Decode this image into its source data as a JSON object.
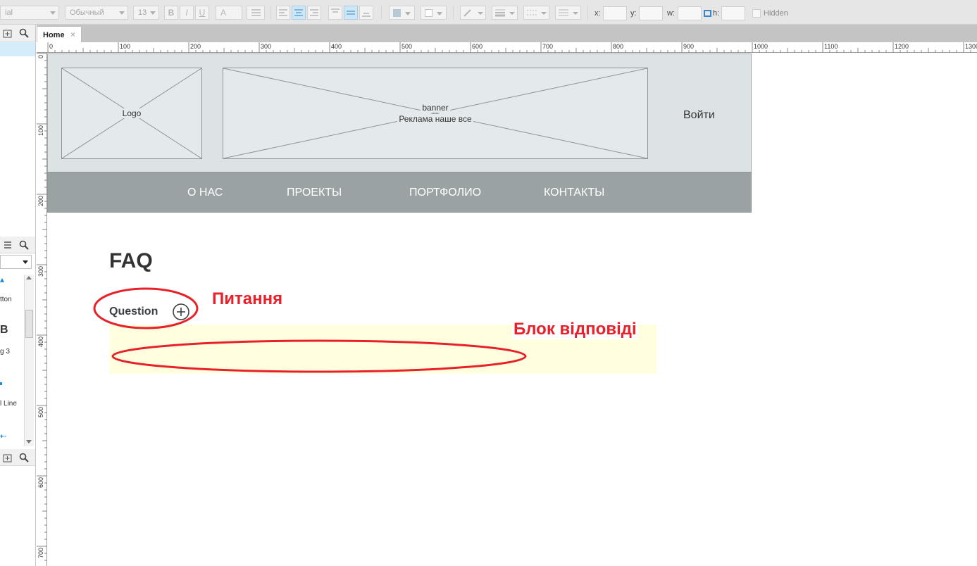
{
  "toolbar": {
    "font_name": "ial",
    "font_style": "Обычный",
    "font_size": "13",
    "bold": "B",
    "italic": "I",
    "underline": "U",
    "text_color": "A",
    "x_label": "x:",
    "y_label": "y:",
    "w_label": "w:",
    "h_label": "h:",
    "hidden_label": "Hidden"
  },
  "sidebar": {
    "library_items": [
      "tton",
      "g 3",
      "l Line"
    ],
    "library_glyphs": [
      "B"
    ]
  },
  "tabs": [
    {
      "label": "Home",
      "close": "×"
    }
  ],
  "ruler": {
    "h_ticks": [
      "0",
      "100",
      "200",
      "300",
      "400",
      "500",
      "600",
      "700",
      "800",
      "900",
      "1000",
      "1100",
      "1200",
      "1300"
    ],
    "v_ticks": [
      "0",
      "100",
      "200",
      "300",
      "400",
      "500",
      "600",
      "700"
    ]
  },
  "wireframe": {
    "logo_label": "Logo",
    "banner_line1": "banner",
    "banner_line2": "Реклама наше все",
    "login_label": "Войти",
    "nav": [
      "О НАС",
      "ПРОЕКТЫ",
      "ПОРТФОЛИО",
      "КОНТАКТЫ"
    ],
    "faq_title": "FAQ",
    "question_label": "Question"
  },
  "annotations": {
    "question_note": "Питання",
    "answer_note": "Блок відповіді",
    "color": "#e8202a"
  },
  "colors": {
    "header_bg": "#dde3e5",
    "nav_bg": "#9aa2a3",
    "answer_bg": "#ffffe0",
    "selection": "#d5ecfa"
  }
}
